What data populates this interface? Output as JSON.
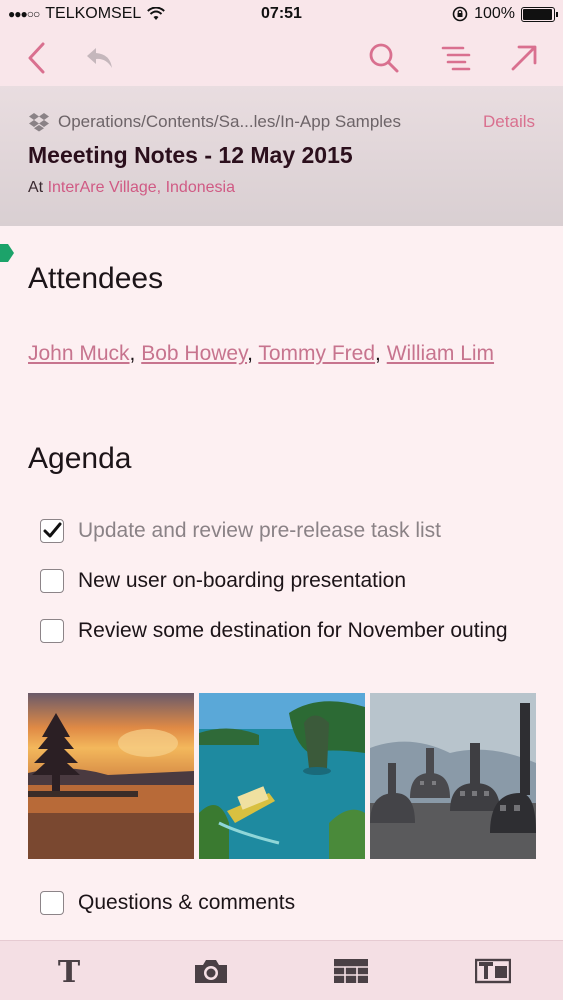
{
  "status_bar": {
    "signal_dots": "●●●○○",
    "carrier": "TELKOMSEL",
    "time": "07:51",
    "battery": "100%",
    "battery_level": 1.0
  },
  "toolbar": {
    "back_icon": "chevron-left-icon",
    "undo_icon": "undo-icon",
    "search_icon": "search-icon",
    "outline_icon": "outline-list-icon",
    "share_icon": "arrow-up-right-icon"
  },
  "header": {
    "path": "Operations/Contents/Sa...les/In-App Samples",
    "details": "Details",
    "title": "Meeeting Notes - 12 May 2015",
    "location_prefix": "At",
    "location": "InterAre Village, Indonesia"
  },
  "content": {
    "attendees_heading": "Attendees",
    "attendees": [
      "John Muck",
      "Bob Howey",
      "Tommy Fred",
      "William Lim"
    ],
    "attendees_separator": ", ",
    "agenda_heading": "Agenda",
    "todos": [
      {
        "text": "Update and review pre-release task list",
        "checked": true
      },
      {
        "text": "New user on-boarding presentation",
        "checked": false
      },
      {
        "text": "Review some destination for November outing",
        "checked": false
      }
    ],
    "photos": [
      "temple-sunset-photo",
      "lagoon-boat-photo",
      "borobudur-stupas-photo"
    ],
    "last_todo": {
      "text": "Questions & comments",
      "checked": false
    }
  },
  "bottom_bar": {
    "text_format_icon": "text-format-icon",
    "camera_icon": "camera-icon",
    "table_icon": "table-icon",
    "text-box_icon": "text-box-icon"
  },
  "colors": {
    "accent": "#d05a84",
    "link": "#c7748e",
    "tag": "#1ca36a",
    "background": "#fdf0f2"
  }
}
